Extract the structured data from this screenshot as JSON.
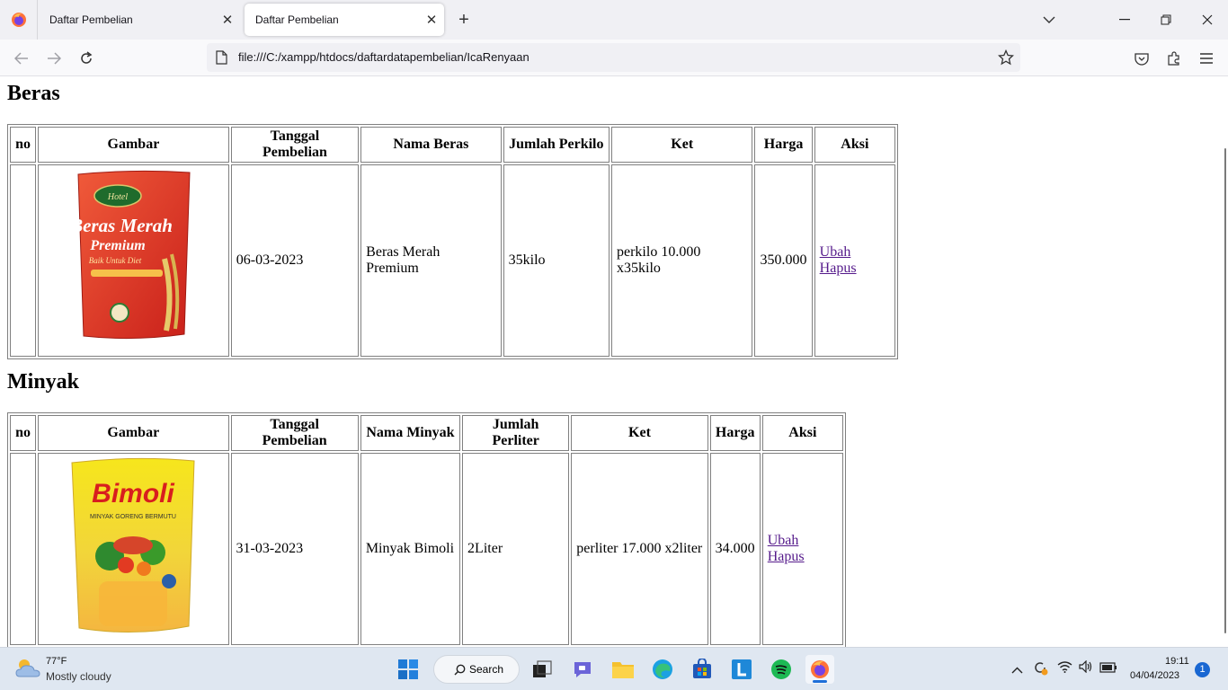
{
  "browser": {
    "tabs": [
      {
        "title": "Daftar Pembelian",
        "close": "✕"
      },
      {
        "title": "Daftar Pembelian",
        "close": "✕"
      }
    ],
    "new_tab": "+",
    "url": "file:///C:/xampp/htdocs/daftardatapembelian/IcaRenyaan"
  },
  "page": {
    "sections": [
      {
        "title": "Beras",
        "headers": [
          "no",
          "Gambar",
          "Tanggal Pembelian",
          "Nama Beras",
          "Jumlah Perkilo",
          "Ket",
          "Harga",
          "Aksi"
        ],
        "row": {
          "no": "",
          "image_brand": "Beras Merah",
          "image_sub": "Premium",
          "image_tag": "Baik Untuk Diet",
          "image_small": "Hotel",
          "date": "06-03-2023",
          "name": "Beras Merah Premium",
          "qty": "35kilo",
          "ket": "perkilo 10.000 x35kilo",
          "harga": "350.000",
          "ubah": "Ubah",
          "hapus": "Hapus"
        }
      },
      {
        "title": "Minyak",
        "headers": [
          "no",
          "Gambar",
          "Tanggal Pembelian",
          "Nama Minyak",
          "Jumlah Perliter",
          "Ket",
          "Harga",
          "Aksi"
        ],
        "row": {
          "no": "",
          "image_brand": "Bimoli",
          "image_sub": "MINYAK GORENG BERMUTU",
          "date": "31-03-2023",
          "name": "Minyak Bimoli",
          "qty": "2Liter",
          "ket": "perliter 17.000 x2liter",
          "harga": "34.000",
          "ubah": "Ubah",
          "hapus": "Hapus"
        }
      }
    ]
  },
  "taskbar": {
    "weather_temp": "77°F",
    "weather_desc": "Mostly cloudy",
    "search_label": "Search",
    "time": "19:11",
    "date": "04/04/2023",
    "notification_count": "1"
  }
}
